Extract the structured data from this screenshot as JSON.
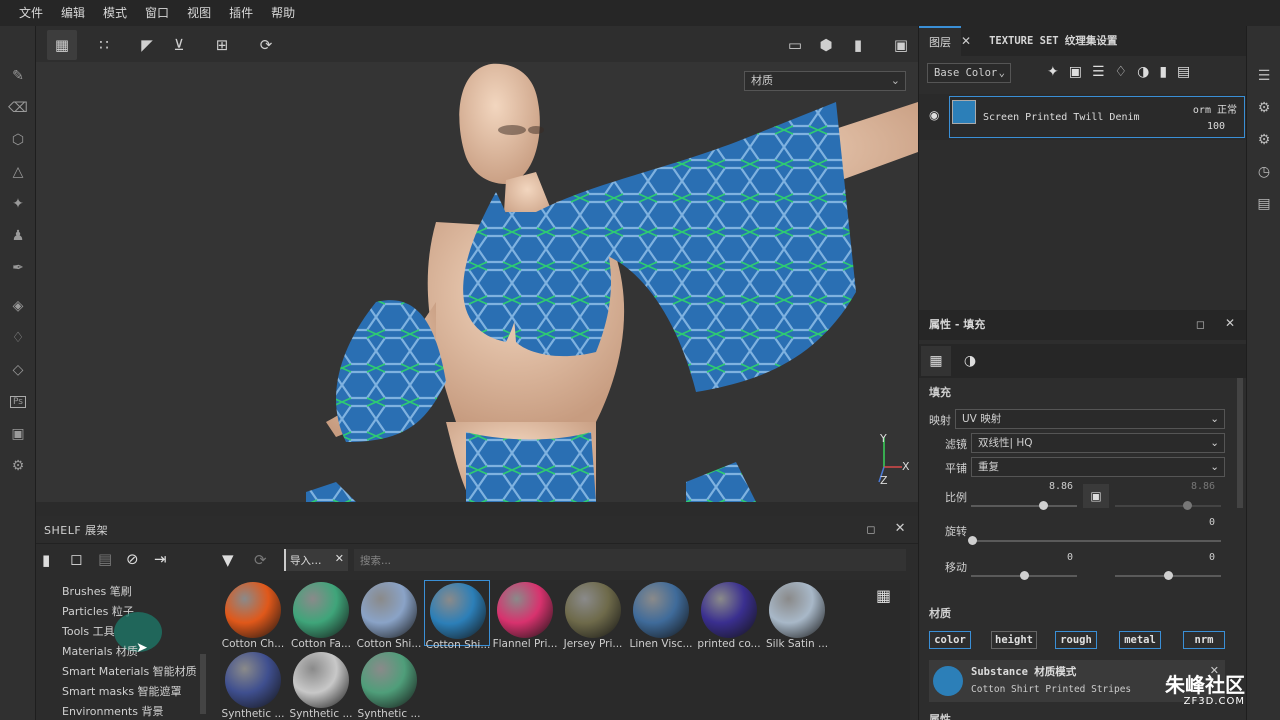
{
  "menu": [
    "文件",
    "编辑",
    "模式",
    "窗口",
    "视图",
    "插件",
    "帮助"
  ],
  "viewport": {
    "display_channel": "材质",
    "axis": {
      "y": "Y",
      "x": "X",
      "z": "Z"
    }
  },
  "shelf": {
    "title": "SHELF 展架",
    "categories": [
      "Brushes 笔刷",
      "Particles 粒子",
      "Tools 工具",
      "Materials 材质",
      "Smart Materials 智能材质",
      "Smart masks 智能遮罩",
      "Environments 背景"
    ],
    "filter_tag": "导入…",
    "search_placeholder": "搜索...",
    "materials": [
      {
        "label": "Cotton Ch...",
        "color": "#e0581a"
      },
      {
        "label": "Cotton Fa...",
        "color": "#3fa57a"
      },
      {
        "label": "Cotton Shi...",
        "color": "#8aa3c7"
      },
      {
        "label": "Cotton Shi...",
        "color": "#2c7fb8"
      },
      {
        "label": "Flannel Pri...",
        "color": "#d8326e"
      },
      {
        "label": "Jersey Pri...",
        "color": "#6e6a4a"
      },
      {
        "label": "Linen Visc...",
        "color": "#3f6b9a"
      },
      {
        "label": "printed co...",
        "color": "#3a2f8f"
      },
      {
        "label": "Silk Satin ...",
        "color": "#a8b8c8"
      },
      {
        "label": "Synthetic ...",
        "color": "#3f4f8f"
      },
      {
        "label": "Synthetic ...",
        "color": "#c8c8c8"
      },
      {
        "label": "Synthetic ...",
        "color": "#4f9e7a"
      }
    ]
  },
  "layers_panel": {
    "tabs": [
      "图层",
      "TEXTURE SET 纹理集设置"
    ],
    "channel": "Base Color",
    "layer": {
      "name": "Screen Printed Twill Denim",
      "blend": "orm 正常",
      "opacity": "100"
    }
  },
  "properties": {
    "title": "属性 - 填充",
    "section_fill": "填充",
    "mapping_label": "映射",
    "mapping_value": "UV 映射",
    "filter_label": "滤镜",
    "filter_value": "双线性| HQ",
    "tiling_label": "平铺",
    "tiling_value": "重复",
    "scale_label": "比例",
    "scale_value": "8.86",
    "scale_value2": "8.86",
    "rotation_label": "旋转",
    "rotation_value": "0",
    "offset_label": "移动",
    "offset_value_u": "0",
    "offset_value_v": "0",
    "section_material": "材质",
    "channels": [
      "color",
      "height",
      "rough",
      "metal",
      "nrm"
    ],
    "substance_title": "Substance 材质模式",
    "substance_name": "Cotton Shirt Printed Stripes",
    "params_label": "属性"
  },
  "watermark": {
    "brand": "朱峰社区",
    "url": "ZF3D.COM"
  }
}
